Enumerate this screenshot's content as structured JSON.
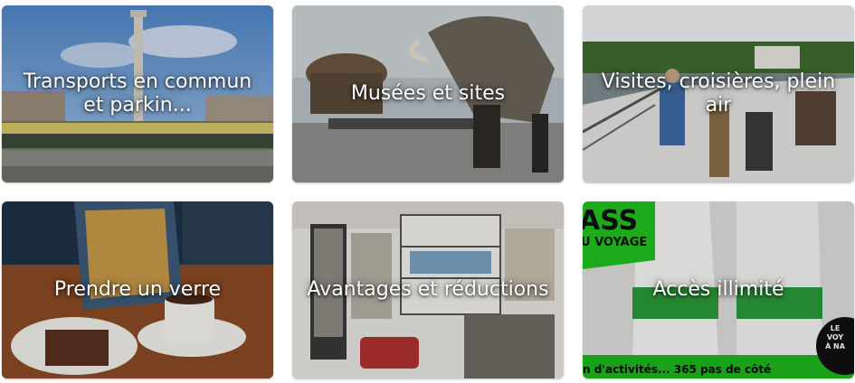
{
  "tiles": [
    {
      "label": "Transports en commun et parkin..."
    },
    {
      "label": "Musées et sites"
    },
    {
      "label": "Visites, croisières, plein air"
    },
    {
      "label": "Prendre un verre"
    },
    {
      "label": "Avantages et réductions"
    },
    {
      "label": "Accès illimité"
    }
  ],
  "pass_banner": {
    "word1": "ASS",
    "word2": "U VOYAGE",
    "footer": "n d'activités... 365 pas de côté",
    "badge": [
      "LE",
      "VOY",
      "À NA"
    ]
  }
}
